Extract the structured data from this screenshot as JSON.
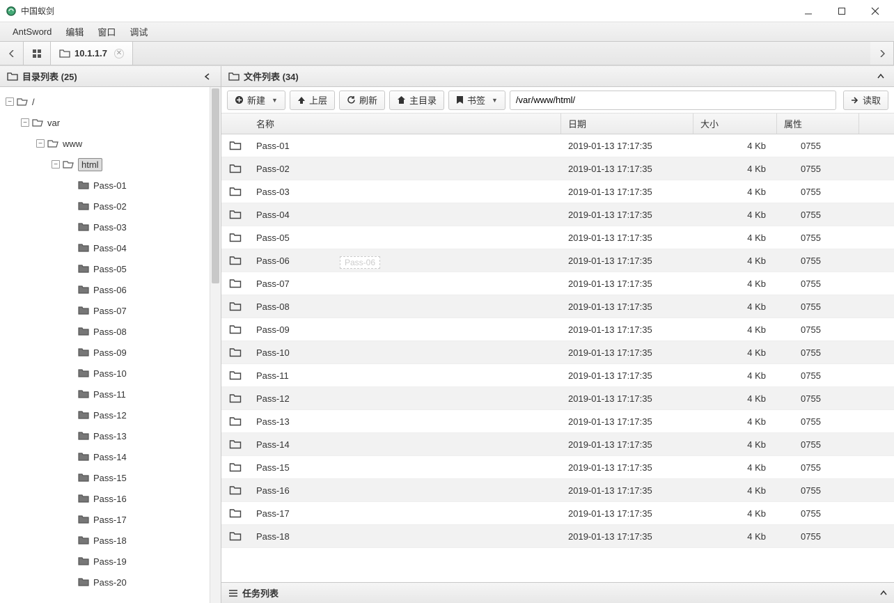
{
  "titlebar": {
    "title": "中国蚁剑"
  },
  "menubar": {
    "items": [
      "AntSword",
      "编辑",
      "窗口",
      "调试"
    ]
  },
  "tabstrip": {
    "home_icon": "grid-icon",
    "active_tab": {
      "label": "10.1.1.7"
    }
  },
  "sidebar": {
    "title": "目录列表 (25)",
    "tree": {
      "root": "/",
      "nodes": [
        {
          "label": "var",
          "depth": 1,
          "expanded": true,
          "children": [
            {
              "label": "www",
              "depth": 2,
              "expanded": true,
              "children": [
                {
                  "label": "html",
                  "depth": 3,
                  "expanded": true,
                  "selected": true,
                  "children": [
                    {
                      "label": "Pass-01",
                      "depth": 4
                    },
                    {
                      "label": "Pass-02",
                      "depth": 4
                    },
                    {
                      "label": "Pass-03",
                      "depth": 4
                    },
                    {
                      "label": "Pass-04",
                      "depth": 4
                    },
                    {
                      "label": "Pass-05",
                      "depth": 4
                    },
                    {
                      "label": "Pass-06",
                      "depth": 4
                    },
                    {
                      "label": "Pass-07",
                      "depth": 4
                    },
                    {
                      "label": "Pass-08",
                      "depth": 4
                    },
                    {
                      "label": "Pass-09",
                      "depth": 4
                    },
                    {
                      "label": "Pass-10",
                      "depth": 4
                    },
                    {
                      "label": "Pass-11",
                      "depth": 4
                    },
                    {
                      "label": "Pass-12",
                      "depth": 4
                    },
                    {
                      "label": "Pass-13",
                      "depth": 4
                    },
                    {
                      "label": "Pass-14",
                      "depth": 4
                    },
                    {
                      "label": "Pass-15",
                      "depth": 4
                    },
                    {
                      "label": "Pass-16",
                      "depth": 4
                    },
                    {
                      "label": "Pass-17",
                      "depth": 4
                    },
                    {
                      "label": "Pass-18",
                      "depth": 4
                    },
                    {
                      "label": "Pass-19",
                      "depth": 4
                    },
                    {
                      "label": "Pass-20",
                      "depth": 4
                    }
                  ]
                }
              ]
            }
          ]
        }
      ]
    }
  },
  "main": {
    "title": "文件列表 (34)",
    "toolbar": {
      "new": "新建",
      "up": "上层",
      "refresh": "刷新",
      "home": "主目录",
      "bookmark": "书签",
      "path": "/var/www/html/",
      "read": "读取"
    },
    "columns": {
      "name": "名称",
      "date": "日期",
      "size": "大小",
      "attr": "属性"
    },
    "ghost": "Pass-06",
    "rows": [
      {
        "name": "Pass-01",
        "date": "2019-01-13 17:17:35",
        "size": "4 Kb",
        "attr": "0755"
      },
      {
        "name": "Pass-02",
        "date": "2019-01-13 17:17:35",
        "size": "4 Kb",
        "attr": "0755"
      },
      {
        "name": "Pass-03",
        "date": "2019-01-13 17:17:35",
        "size": "4 Kb",
        "attr": "0755"
      },
      {
        "name": "Pass-04",
        "date": "2019-01-13 17:17:35",
        "size": "4 Kb",
        "attr": "0755"
      },
      {
        "name": "Pass-05",
        "date": "2019-01-13 17:17:35",
        "size": "4 Kb",
        "attr": "0755"
      },
      {
        "name": "Pass-06",
        "date": "2019-01-13 17:17:35",
        "size": "4 Kb",
        "attr": "0755"
      },
      {
        "name": "Pass-07",
        "date": "2019-01-13 17:17:35",
        "size": "4 Kb",
        "attr": "0755"
      },
      {
        "name": "Pass-08",
        "date": "2019-01-13 17:17:35",
        "size": "4 Kb",
        "attr": "0755"
      },
      {
        "name": "Pass-09",
        "date": "2019-01-13 17:17:35",
        "size": "4 Kb",
        "attr": "0755"
      },
      {
        "name": "Pass-10",
        "date": "2019-01-13 17:17:35",
        "size": "4 Kb",
        "attr": "0755"
      },
      {
        "name": "Pass-11",
        "date": "2019-01-13 17:17:35",
        "size": "4 Kb",
        "attr": "0755"
      },
      {
        "name": "Pass-12",
        "date": "2019-01-13 17:17:35",
        "size": "4 Kb",
        "attr": "0755"
      },
      {
        "name": "Pass-13",
        "date": "2019-01-13 17:17:35",
        "size": "4 Kb",
        "attr": "0755"
      },
      {
        "name": "Pass-14",
        "date": "2019-01-13 17:17:35",
        "size": "4 Kb",
        "attr": "0755"
      },
      {
        "name": "Pass-15",
        "date": "2019-01-13 17:17:35",
        "size": "4 Kb",
        "attr": "0755"
      },
      {
        "name": "Pass-16",
        "date": "2019-01-13 17:17:35",
        "size": "4 Kb",
        "attr": "0755"
      },
      {
        "name": "Pass-17",
        "date": "2019-01-13 17:17:35",
        "size": "4 Kb",
        "attr": "0755"
      },
      {
        "name": "Pass-18",
        "date": "2019-01-13 17:17:35",
        "size": "4 Kb",
        "attr": "0755"
      }
    ]
  },
  "tasklist": {
    "title": "任务列表"
  }
}
